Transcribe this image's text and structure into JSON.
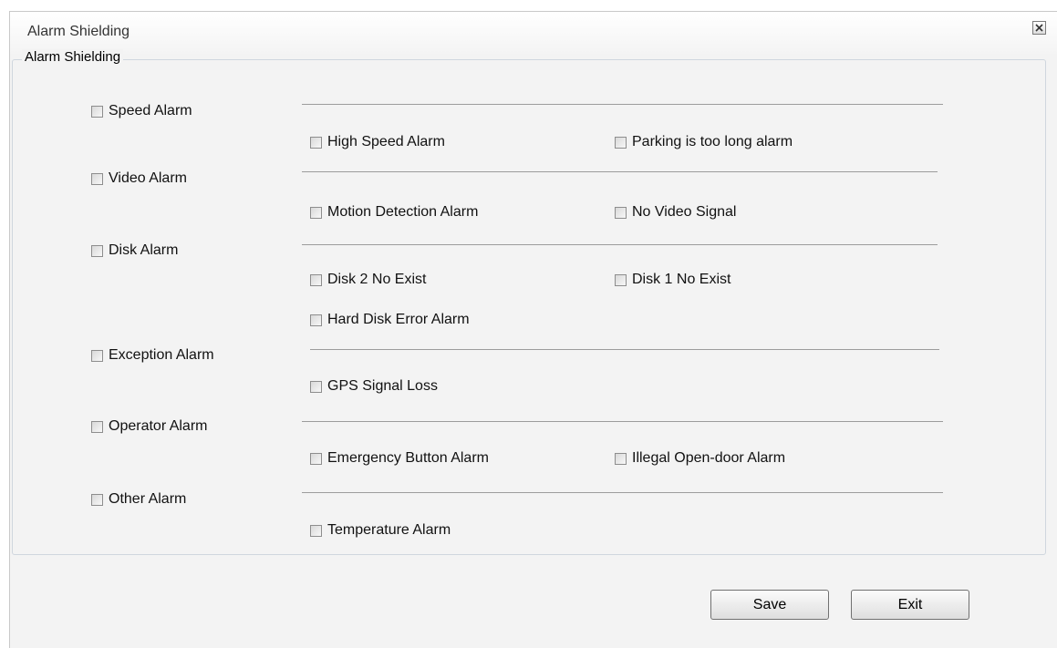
{
  "dialog": {
    "title": "Alarm Shielding"
  },
  "group": {
    "legend": "Alarm Shielding"
  },
  "categories": [
    {
      "label": "Speed Alarm",
      "checked": false
    },
    {
      "label": "Video Alarm",
      "checked": false
    },
    {
      "label": "Disk Alarm",
      "checked": false
    },
    {
      "label": "Exception Alarm",
      "checked": false
    },
    {
      "label": "Operator Alarm",
      "checked": false
    },
    {
      "label": "Other Alarm",
      "checked": false
    }
  ],
  "items": {
    "high_speed": "High Speed Alarm",
    "parking_too_long": "Parking is too long alarm",
    "motion_detection": "Motion Detection Alarm",
    "no_video_signal": "No Video Signal",
    "disk2_no_exist": "Disk 2 No Exist",
    "disk1_no_exist": "Disk 1 No Exist",
    "hard_disk_error": "Hard Disk Error Alarm",
    "gps_signal_loss": "GPS Signal Loss",
    "emergency_button": "Emergency Button Alarm",
    "illegal_open_door": "Illegal Open-door Alarm",
    "temperature": "Temperature Alarm"
  },
  "buttons": {
    "save": "Save",
    "exit": "Exit"
  }
}
